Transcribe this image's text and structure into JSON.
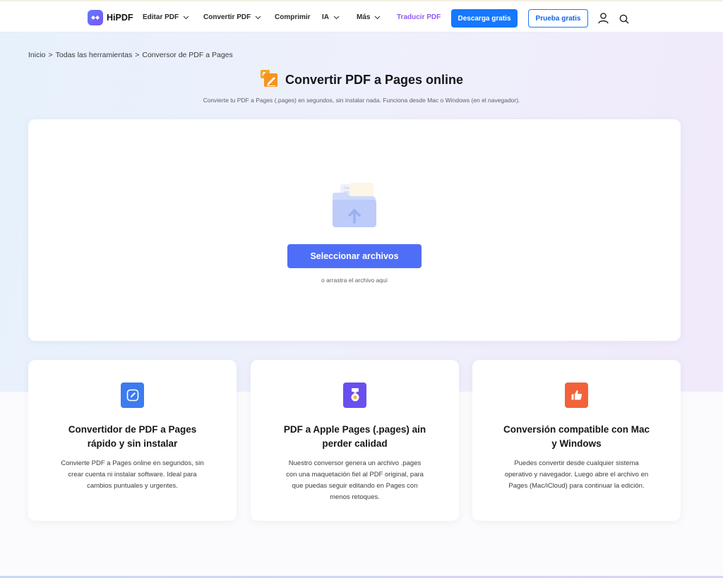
{
  "nav": {
    "logo": "HiPDF",
    "items": [
      {
        "label": "Editar PDF",
        "dropdown": true
      },
      {
        "label": "Convertir PDF",
        "dropdown": true
      },
      {
        "label": "Comprimir",
        "dropdown": false
      },
      {
        "label": "IA",
        "dropdown": true
      },
      {
        "label": "Más",
        "dropdown": true
      },
      {
        "label": "Traducir PDF",
        "dropdown": false
      }
    ],
    "download_label": "Descarga gratis",
    "trial_label": "Prueba gratis",
    "icons": [
      "user-icon",
      "search-icon"
    ]
  },
  "breadcrumb": {
    "items": [
      "Inicio",
      "Todas las herramientas",
      "Conversor de PDF a Pages"
    ],
    "separator": ">"
  },
  "hero": {
    "title": "Convertir PDF a Pages online",
    "subtitle": "Convierte tu PDF a Pages (.pages) en segundos, sin instalar nada. Funciona desde Mac o Windows (en el navegador)."
  },
  "upload": {
    "button_label": "Seleccionar archivos",
    "hint": "o arrastra el archivo aquí"
  },
  "features": [
    {
      "icon": "edit-icon",
      "color": "#3d7bf0",
      "title_lines": [
        "Convertidor de PDF a Pages",
        "rápido y sin instalar"
      ],
      "desc_lines": [
        "Convierte PDF a Pages online en segundos, sin",
        "crear cuenta ni instalar software. Ideal para",
        "cambios puntuales y urgentes."
      ]
    },
    {
      "icon": "medal-icon",
      "color": "#6a4ff0",
      "title_lines": [
        "PDF a Apple Pages (.pages) ain",
        "perder calidad"
      ],
      "desc_lines": [
        "Nuestro conversor genera un archivo .pages",
        "con una maquetación fiel al PDF original, para",
        "que puedas seguir editando en Pages con",
        "menos retoques."
      ]
    },
    {
      "icon": "thumbs-up-icon",
      "color": "#f2623a",
      "title_lines": [
        "Conversión compatible con Mac",
        "y Windows"
      ],
      "desc_lines": [
        "Puedes convertir desde cualquier sistema",
        "operativo y navegador. Luego abre el archivo en",
        "Pages (Mac/iCloud) para continuar la edición."
      ]
    }
  ],
  "colors": {
    "primary": "#1677ff",
    "select_button": "#4f6ef7",
    "translate_accent": "#8f5cf7"
  }
}
